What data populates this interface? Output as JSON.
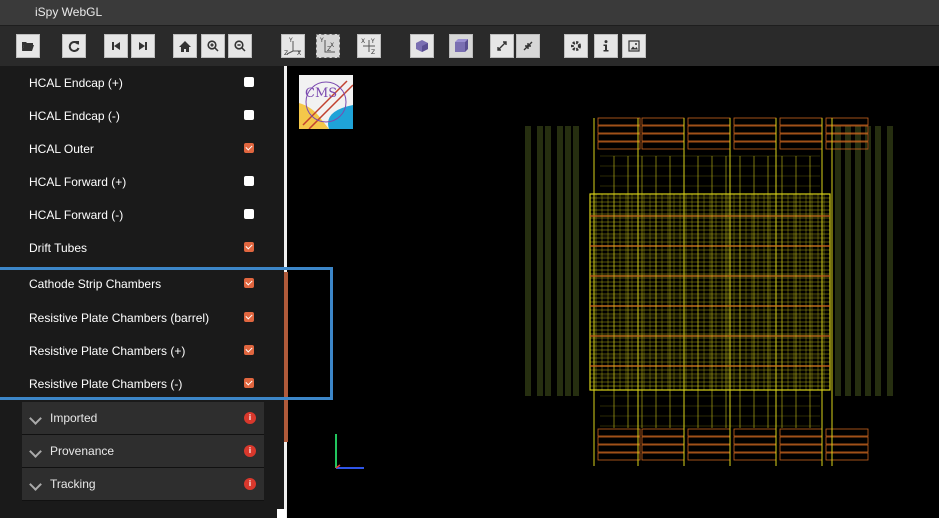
{
  "app": {
    "title": "iSpy WebGL"
  },
  "toolbar": {
    "buttons": [
      {
        "name": "open-file-button",
        "icon": "folder-open-icon"
      },
      {
        "name": "reload-button",
        "icon": "refresh-icon"
      },
      {
        "name": "previous-event-button",
        "icon": "step-backward-icon"
      },
      {
        "name": "next-event-button",
        "icon": "step-forward-icon"
      },
      {
        "name": "home-button",
        "icon": "home-icon"
      },
      {
        "name": "zoom-in-button",
        "icon": "zoom-in-icon"
      },
      {
        "name": "zoom-out-button",
        "icon": "zoom-out-icon"
      },
      {
        "name": "view-3d-button",
        "icon": "axes-3d-icon",
        "axes": [
          "Y",
          "Z",
          "X"
        ]
      },
      {
        "name": "view-rphi-button",
        "icon": "axes-rphi-icon",
        "axes": [
          "Y",
          "X",
          "Z"
        ]
      },
      {
        "name": "view-rz-button",
        "icon": "axes-rz-icon",
        "axes": [
          "X",
          "Y",
          "Z"
        ]
      },
      {
        "name": "perspective-button",
        "icon": "cube-perspective-icon"
      },
      {
        "name": "orthographic-button",
        "icon": "cube-ortho-icon"
      },
      {
        "name": "enter-fullscreen-button",
        "icon": "expand-icon"
      },
      {
        "name": "exit-fullscreen-button",
        "icon": "compress-icon"
      },
      {
        "name": "settings-button",
        "icon": "gear-icon"
      },
      {
        "name": "info-button",
        "icon": "info-icon"
      },
      {
        "name": "screenshot-button",
        "icon": "image-icon"
      }
    ]
  },
  "sidebar": {
    "items": [
      {
        "label": "HCAL Endcap (+)",
        "checked": false
      },
      {
        "label": "HCAL Endcap (-)",
        "checked": false
      },
      {
        "label": "HCAL Outer",
        "checked": true
      },
      {
        "label": "HCAL Forward (+)",
        "checked": false
      },
      {
        "label": "HCAL Forward (-)",
        "checked": false
      },
      {
        "label": "Drift Tubes",
        "checked": true
      },
      {
        "label": "Cathode Strip Chambers",
        "checked": true
      },
      {
        "label": "Resistive Plate Chambers (barrel)",
        "checked": true
      },
      {
        "label": "Resistive Plate Chambers (+)",
        "checked": true
      },
      {
        "label": "Resistive Plate Chambers (-)",
        "checked": true
      }
    ],
    "sections": [
      {
        "label": "Imported",
        "badge": "i"
      },
      {
        "label": "Provenance",
        "badge": "i"
      },
      {
        "label": "Tracking",
        "badge": "i"
      }
    ]
  },
  "viewport": {
    "logo": "CMS"
  },
  "colors": {
    "checkbox_on": "#e0663f",
    "highlight": "#3c86c8",
    "badge": "#d9382c",
    "detector_yellow": "#d9d21a",
    "detector_orange": "#c8641e",
    "detector_green": "#8fae3a"
  }
}
